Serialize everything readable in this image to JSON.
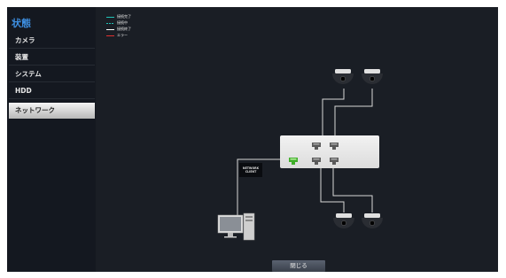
{
  "sidebar": {
    "title": "状態",
    "items": [
      {
        "label": "カメラ"
      },
      {
        "label": "装置"
      },
      {
        "label": "システム"
      },
      {
        "label": "HDD"
      },
      {
        "label": "ネットワーク",
        "active": true
      }
    ]
  },
  "legend": [
    {
      "label": "接続完了",
      "color": "#21c4b8",
      "style": "solid"
    },
    {
      "label": "接続中",
      "color": "#21c4b8",
      "style": "dashed"
    },
    {
      "label": "接続終了",
      "color": "#ffffff",
      "style": "solid"
    },
    {
      "label": "エラー",
      "color": "#e23030",
      "style": "solid"
    }
  ],
  "network": {
    "client_label_line1": "NETWORK",
    "client_label_line2": "CLIENT",
    "camera_count": 4,
    "hub_port_status": [
      "connected",
      "disconnected",
      "disconnected",
      "disconnected",
      "disconnected",
      "disconnected"
    ]
  },
  "close_button": {
    "label": "閉じる"
  },
  "colors": {
    "accent": "#3d8ee0",
    "connected_port": "#3fae2a",
    "line": "#d8d8d8"
  }
}
